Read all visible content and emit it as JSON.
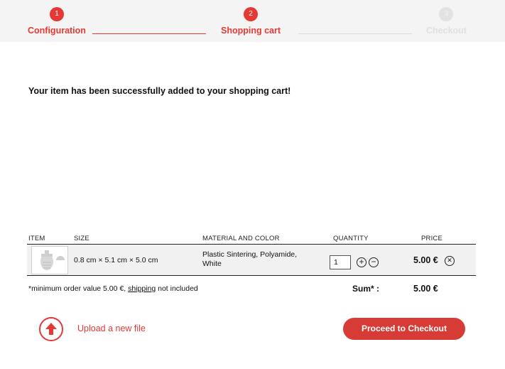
{
  "steps": [
    {
      "number": "1",
      "label": "Configuration",
      "state": "active"
    },
    {
      "number": "2",
      "label": "Shopping cart",
      "state": "active"
    },
    {
      "number": "3",
      "label": "Checkout",
      "state": "inactive"
    }
  ],
  "message": "Your item has been successfully added to your shopping cart!",
  "table": {
    "headers": {
      "item": "ITEM",
      "size": "SIZE",
      "material": "MATERIAL AND COLOR",
      "quantity": "QUANTITY",
      "price": "PRICE"
    },
    "rows": [
      {
        "size": "0.8 cm × 5.1 cm × 5.0 cm",
        "material": "Plastic Sintering, Polyamide, White",
        "quantity": "1",
        "price": "5.00 €"
      }
    ]
  },
  "footer": {
    "note_prefix": "*minimum order value 5.00 €, ",
    "shipping_link": "shipping",
    "note_suffix": " not included",
    "sum_label": "Sum* :",
    "sum_value": "5.00 €"
  },
  "actions": {
    "upload_label": "Upload a new file",
    "checkout_label": "Proceed to Checkout"
  },
  "icons": {
    "increase": "plus-circle-icon",
    "decrease": "minus-circle-icon",
    "remove": "close-circle-icon",
    "upload": "arrow-up-icon"
  },
  "colors": {
    "accent": "#e53935",
    "button": "#d63b35"
  }
}
